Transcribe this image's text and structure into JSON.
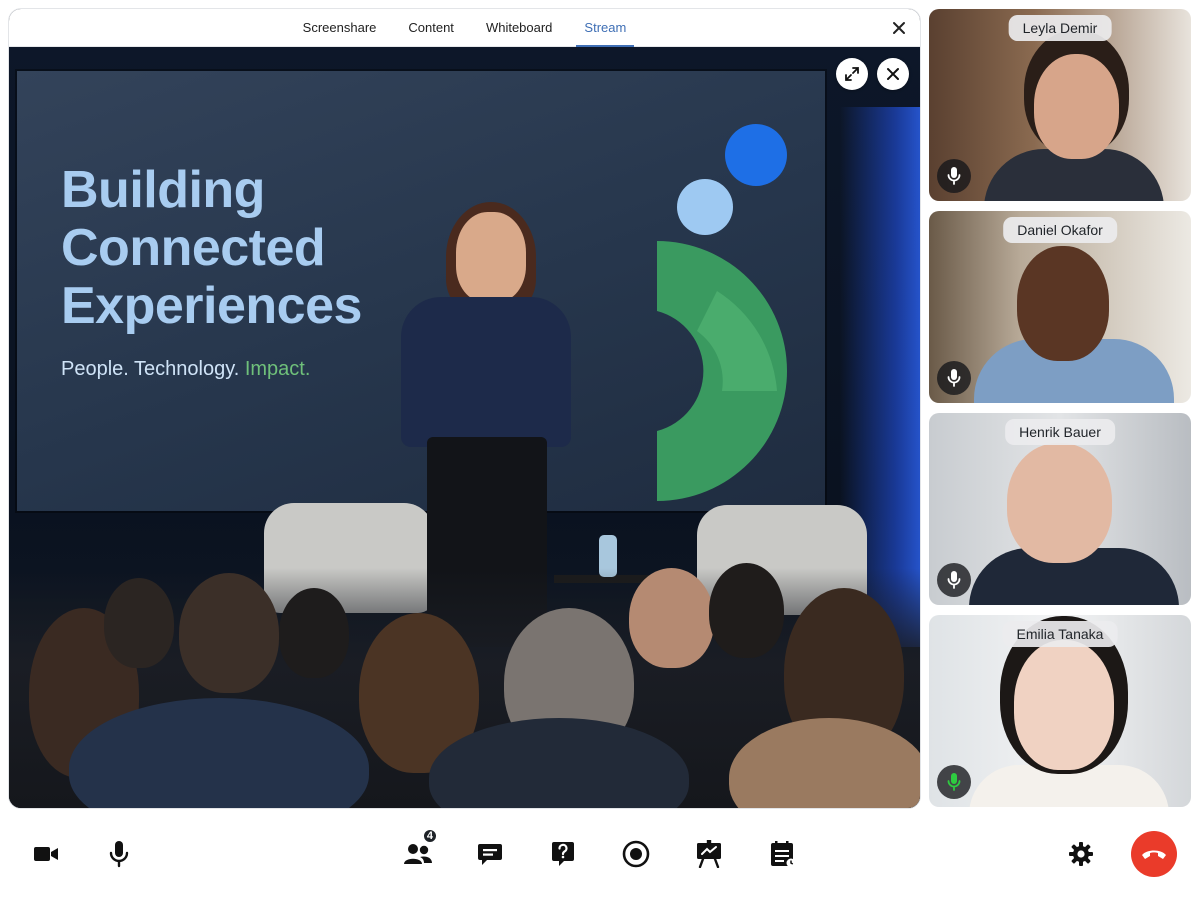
{
  "tabs": [
    {
      "label": "Screenshare",
      "active": false
    },
    {
      "label": "Content",
      "active": false
    },
    {
      "label": "Whiteboard",
      "active": false
    },
    {
      "label": "Stream",
      "active": true
    }
  ],
  "slide": {
    "title_lines": [
      "Building",
      "Connected",
      "Experiences"
    ],
    "subtitle": "People. Technology.",
    "subtitle_accent": "Impact."
  },
  "stage_controls": {
    "expand_icon": "expand-icon",
    "close_icon": "close-icon"
  },
  "participants": [
    {
      "name": "Leyla Demir",
      "mic": "unmuted",
      "speaking": false
    },
    {
      "name": "Daniel Okafor",
      "mic": "unmuted",
      "speaking": false
    },
    {
      "name": "Henrik Bauer",
      "mic": "unmuted",
      "speaking": false
    },
    {
      "name": "Emilia Tanaka",
      "mic": "unmuted",
      "speaking": true
    }
  ],
  "toolbar": {
    "left": [
      "camera-icon",
      "microphone-icon"
    ],
    "center": [
      "participants-icon",
      "chat-icon",
      "qa-icon",
      "record-icon",
      "presentation-icon",
      "agenda-icon"
    ],
    "right": [
      "settings-icon",
      "end-call-icon"
    ],
    "participants_count": "4"
  },
  "colors": {
    "active_tab": "#3f6fb5",
    "speaking_mic": "#2ecc40",
    "end_call": "#ea3b2a",
    "slide_title": "#a8ccf0",
    "slide_accent": "#6fc07a"
  }
}
